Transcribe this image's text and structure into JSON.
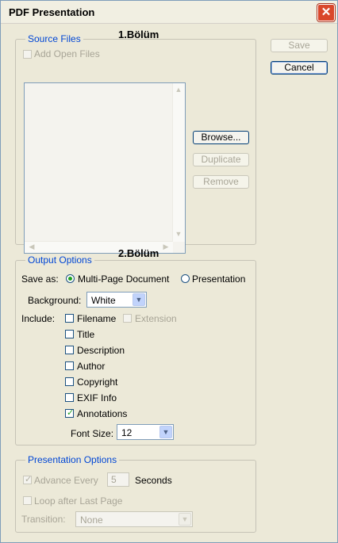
{
  "window": {
    "title": "PDF Presentation",
    "close_glyph": "✕"
  },
  "buttons": {
    "save": "Save",
    "cancel": "Cancel"
  },
  "source_files": {
    "legend": "Source Files",
    "section_note": "1.Bölüm",
    "add_open_files": "Add Open Files",
    "browse": "Browse...",
    "duplicate": "Duplicate",
    "remove": "Remove"
  },
  "output_options": {
    "legend": "Output Options",
    "section_note": "2.Bölüm",
    "save_as_label": "Save as:",
    "save_as_options": [
      "Multi-Page Document",
      "Presentation"
    ],
    "save_as_selected": "Multi-Page Document",
    "background_label": "Background:",
    "background_value": "White",
    "include_label": "Include:",
    "include_items": [
      {
        "label": "Filename",
        "checked": false
      },
      {
        "label": "Extension",
        "checked": false,
        "disabled": true
      },
      {
        "label": "Title",
        "checked": false
      },
      {
        "label": "Description",
        "checked": false
      },
      {
        "label": "Author",
        "checked": false
      },
      {
        "label": "Copyright",
        "checked": false
      },
      {
        "label": "EXIF Info",
        "checked": false
      },
      {
        "label": "Annotations",
        "checked": true
      }
    ],
    "font_size_label": "Font Size:",
    "font_size_value": "12"
  },
  "presentation_options": {
    "legend": "Presentation Options",
    "advance_every": "Advance Every",
    "advance_checked": true,
    "seconds_value": "5",
    "seconds_label": "Seconds",
    "loop_after_last_page": "Loop after Last Page",
    "transition_label": "Transition:",
    "transition_value": "None"
  },
  "icons": {
    "check": "✓",
    "arrow_down": "▼",
    "arrow_up": "▲",
    "arrow_left": "◀",
    "arrow_right": "▶"
  },
  "colors": {
    "legend_blue": "#0046d5",
    "close_red": "#d9472b",
    "check_green": "#21a121"
  }
}
